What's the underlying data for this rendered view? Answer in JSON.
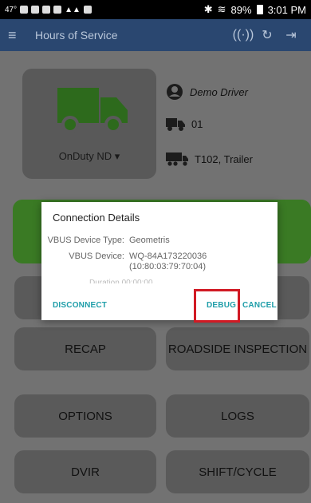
{
  "status_bar": {
    "left_text": "47°",
    "battery": "89%",
    "time": "3:01 PM"
  },
  "app_bar": {
    "title": "Hours of Service"
  },
  "main": {
    "duty_status": "OnDuty ND",
    "driver_name": "Demo Driver",
    "vehicle": "01",
    "trailer": "T102, Trailer",
    "buttons": {
      "recap": "RECAP",
      "roadside": "ROADSIDE INSPECTION",
      "options": "OPTIONS",
      "logs": "LOGS",
      "dvir": "DVIR",
      "shift_cycle": "SHIFT/CYCLE"
    }
  },
  "dialog": {
    "title": "Connection Details",
    "device_type_label": "VBUS Device Type:",
    "device_type_value": "Geometris",
    "device_label": "VBUS Device:",
    "device_value": "WQ-84A173220036",
    "device_mac": "(10:80:03:79:70:04)",
    "faded_row": "Duration  00:00:00",
    "disconnect": "DISCONNECT",
    "debug": "DEBUG",
    "cancel": "CANCEL"
  },
  "colors": {
    "app_bar": "#2a4770",
    "accent_green": "#3a7a24",
    "dialog_button": "#1f9ea9",
    "highlight": "#d11a24"
  }
}
